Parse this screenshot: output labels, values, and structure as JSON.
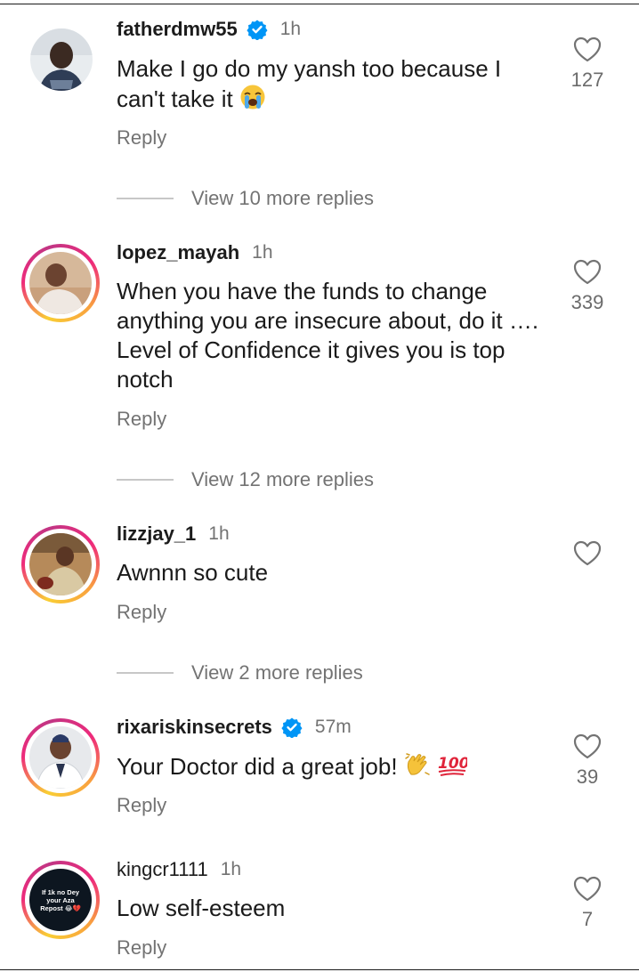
{
  "comments": [
    {
      "username": "fatherdmw55",
      "verified": true,
      "time": "1h",
      "text": "Make I go do my yansh too because I can't take it",
      "emoji": "crying-face",
      "reply": "Reply",
      "likes": "127"
    },
    {
      "username": "lopez_mayah",
      "verified": false,
      "time": "1h",
      "text": "When you have the funds to change anything you are insecure about, do it …. Level of Confidence it gives you is top notch",
      "reply": "Reply",
      "likes": "339"
    },
    {
      "username": "lizzjay_1",
      "verified": false,
      "time": "1h",
      "text": "Awnnn so cute",
      "reply": "Reply",
      "likes": ""
    },
    {
      "username": "rixariskinsecrets",
      "verified": true,
      "time": "57m",
      "text": "Your Doctor did a great job!",
      "emoji": "clapping-hands 100",
      "reply": "Reply",
      "likes": "39"
    },
    {
      "username": "kingcr1111",
      "verified": false,
      "time": "1h",
      "text": "Low self-esteem",
      "reply": "Reply",
      "likes": "7",
      "avatar_text": "If 1k no Dey your Aza Repost 😂💔"
    }
  ],
  "view_more": [
    "View 10 more replies",
    "View 12 more replies",
    "View 2 more replies"
  ],
  "colors": {
    "verified": "#0095f6",
    "muted": "#737373",
    "ring": "#ee2a7b"
  }
}
